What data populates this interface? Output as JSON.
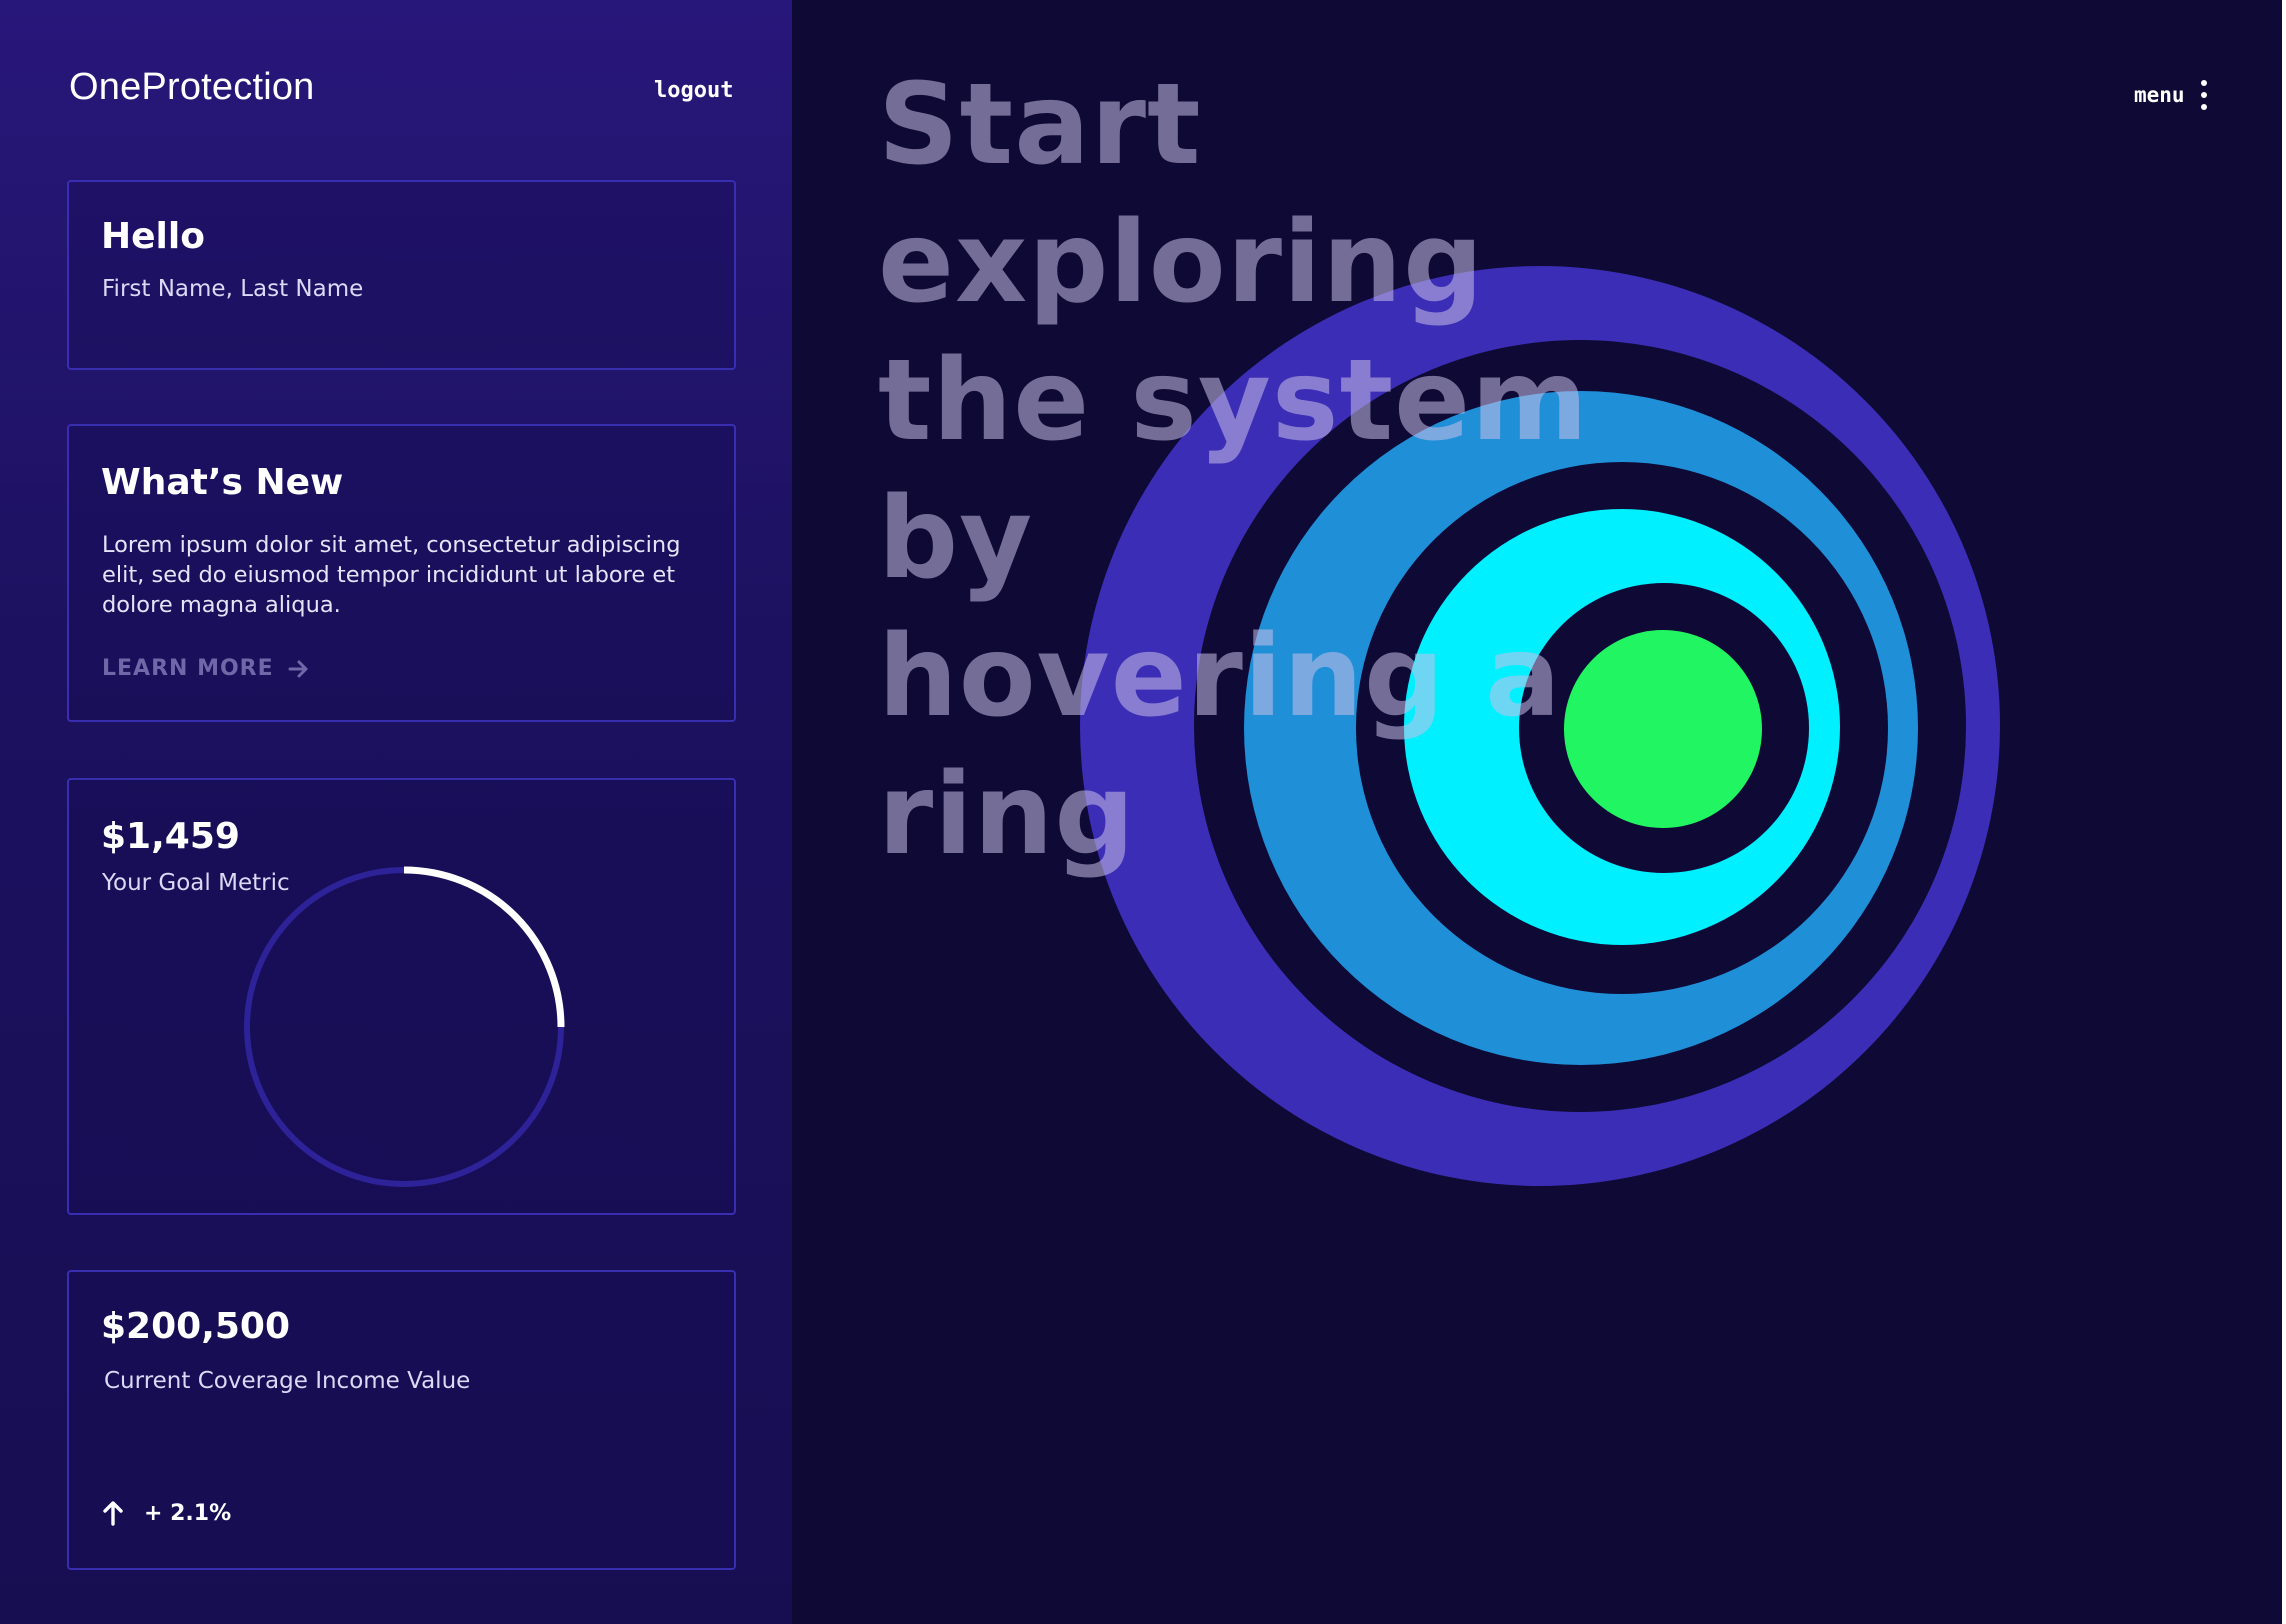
{
  "header": {
    "brand": "OneProtection",
    "logout_label": "logout",
    "menu_label": "menu"
  },
  "hello_card": {
    "title": "Hello",
    "name": "First Name, Last Name"
  },
  "news_card": {
    "title": "What’s New",
    "body": "Lorem ipsum dolor sit amet, consectetur adipiscing elit, sed do eiusmod tempor incididunt ut labore et dolore magna aliqua.",
    "link_label": "LEARN MORE"
  },
  "goal_card": {
    "value": "$1,459",
    "label": "Your Goal Metric",
    "progress_fraction": 0.25
  },
  "coverage_card": {
    "value": "$200,500",
    "label": "Current Coverage Income Value",
    "change": "+ 2.1%"
  },
  "hero": {
    "headline": "Start exploring the system by hovering a ring"
  },
  "rings": {
    "colors": {
      "outer": "#3b2db5",
      "middle": "#1f8fd8",
      "inner": "#00f0ff",
      "core": "#22f562",
      "gap": "#0e0a35"
    }
  },
  "theme": {
    "accent": "#3a2eb0",
    "background": "#0e0a35"
  }
}
